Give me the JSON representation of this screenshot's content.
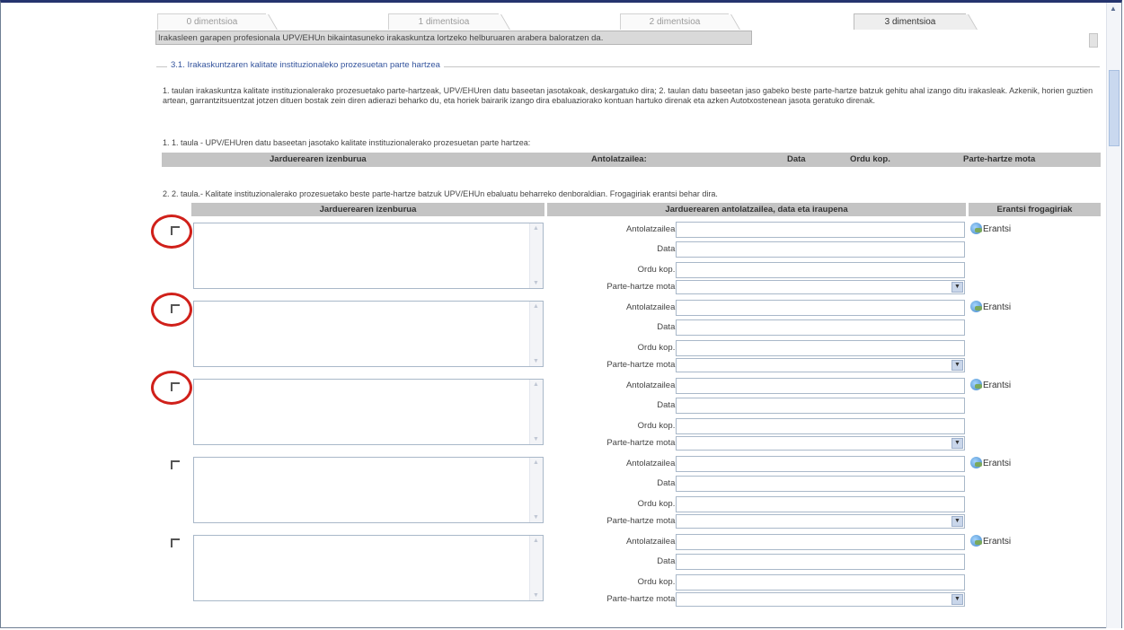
{
  "tabs": [
    "0 dimentsioa",
    "1 dimentsioa",
    "2 dimentsioa",
    "3 dimentsioa"
  ],
  "active_tab_index": 3,
  "banner": "Irakasleen garapen profesionala UPV/EHUn bikaintasuneko irakaskuntza lortzeko helburuaren arabera baloratzen da.",
  "section_title": "3.1. Irakaskuntzaren kalitate instituzionaleko prozesuetan parte hartzea",
  "paragraph": "1. taulan irakaskuntza kalitate instituzionalerako prozesuetako parte-hartzeak, UPV/EHUren datu baseetan jasotakoak, deskargatuko dira; 2. taulan datu baseetan jaso gabeko beste parte-hartze batzuk gehitu ahal izango ditu irakasleak. Azkenik, horien guztien artean, garrantzitsuentzat jotzen dituen bostak zein diren adierazi beharko du, eta horiek bairarik izango dira ebaluaziorako kontuan hartuko direnak eta azken Autotxostenean jasota geratuko direnak.",
  "table1": {
    "caption": "1. 1. taula - UPV/EHUren datu baseetan jasotako kalitate instituzionalerako prozesuetan parte hartzea:",
    "headers": [
      "Jarduerearen izenburua",
      "Antolatzailea:",
      "Data",
      "Ordu kop.",
      "Parte-hartze mota"
    ]
  },
  "table2": {
    "caption": "2. 2. taula.- Kalitate instituzionalerako prozesuetako beste parte-hartze batzuk UPV/EHUn ebaluatu beharreko denboraldian. Frogagiriak erantsi behar dira.",
    "headers": [
      "Jarduerearen izenburua",
      "Jarduerearen antolatzailea, data eta iraupena",
      "Erantsi frogagiriak"
    ],
    "field_labels": {
      "organizer": "Antolatzailea:",
      "date": "Data:",
      "hours": "Ordu kop.:",
      "type": "Parte-hartze mota:"
    },
    "attach_label": "Erantsi",
    "rows": [
      {
        "circled": true
      },
      {
        "circled": true
      },
      {
        "circled": true
      },
      {
        "circled": false
      },
      {
        "circled": false
      }
    ]
  },
  "colors": {
    "title_blue": "#34549d",
    "circle_red": "#d0201a",
    "header_gray": "#c4c4c4"
  },
  "icons": {
    "attach": "globe-icon",
    "checkbox": "checkbox-icon"
  }
}
